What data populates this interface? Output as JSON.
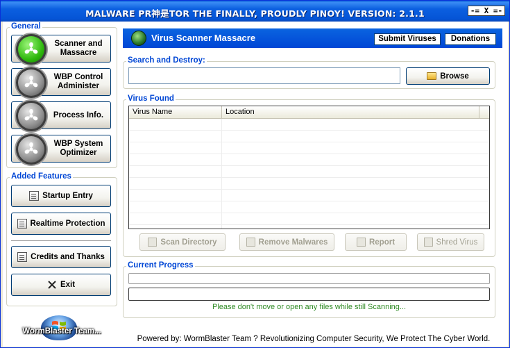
{
  "window": {
    "title": "MALWARE PR神是TOR THE FINALLY, PROUDLY PINOY! VERSION: 2.1.1",
    "control_button": "-= X =-"
  },
  "sidebar": {
    "general_title": "General",
    "nav": [
      {
        "label_line1": "Scanner and",
        "label_line2": "Massacre",
        "icon": "green-fan-orb-icon",
        "active": true
      },
      {
        "label_line1": "WBP Control",
        "label_line2": "Administer",
        "icon": "grey-fan-orb-icon",
        "active": false
      },
      {
        "label_line1": "Process Info.",
        "label_line2": "",
        "icon": "grey-fan-orb-icon",
        "active": false
      },
      {
        "label_line1": "WBP System",
        "label_line2": "Optimizer",
        "icon": "grey-fan-orb-icon",
        "active": false
      }
    ],
    "added_title": "Added Features",
    "features": [
      {
        "label": "Startup Entry",
        "icon": "document-icon"
      },
      {
        "label": "Realtime Protection",
        "icon": "document-icon"
      },
      {
        "label": "Credits and Thanks",
        "icon": "document-icon"
      },
      {
        "label": "Exit",
        "icon": "close-x-icon"
      }
    ],
    "logo_text": "WormBlaster Team..."
  },
  "header": {
    "title": "Virus Scanner Massacre",
    "submit_label": "Submit Viruses",
    "donate_label": "Donations"
  },
  "search": {
    "group_title": "Search and Destroy:",
    "path_value": "",
    "browse_label": "Browse"
  },
  "virus_found": {
    "group_title": "Virus Found",
    "columns": [
      "Virus Name",
      "Location"
    ],
    "rows": []
  },
  "actions": {
    "scan_label": "Scan Directory",
    "remove_label": "Remove Malwares",
    "report_label": "Report",
    "shred_label": "Shred Virus"
  },
  "progress": {
    "group_title": "Current Progress",
    "value_top": 0,
    "value_bottom": 0,
    "status_text": "Please don't move or open any files while still Scanning...",
    "status_color": "#2F8A24"
  },
  "footer": {
    "text": "Powered by: WormBlaster Team ? Revolutionizing Computer Security, We Protect The Cyber World."
  },
  "colors": {
    "accent": "#0046D5",
    "title_bar": "#0554D6"
  }
}
